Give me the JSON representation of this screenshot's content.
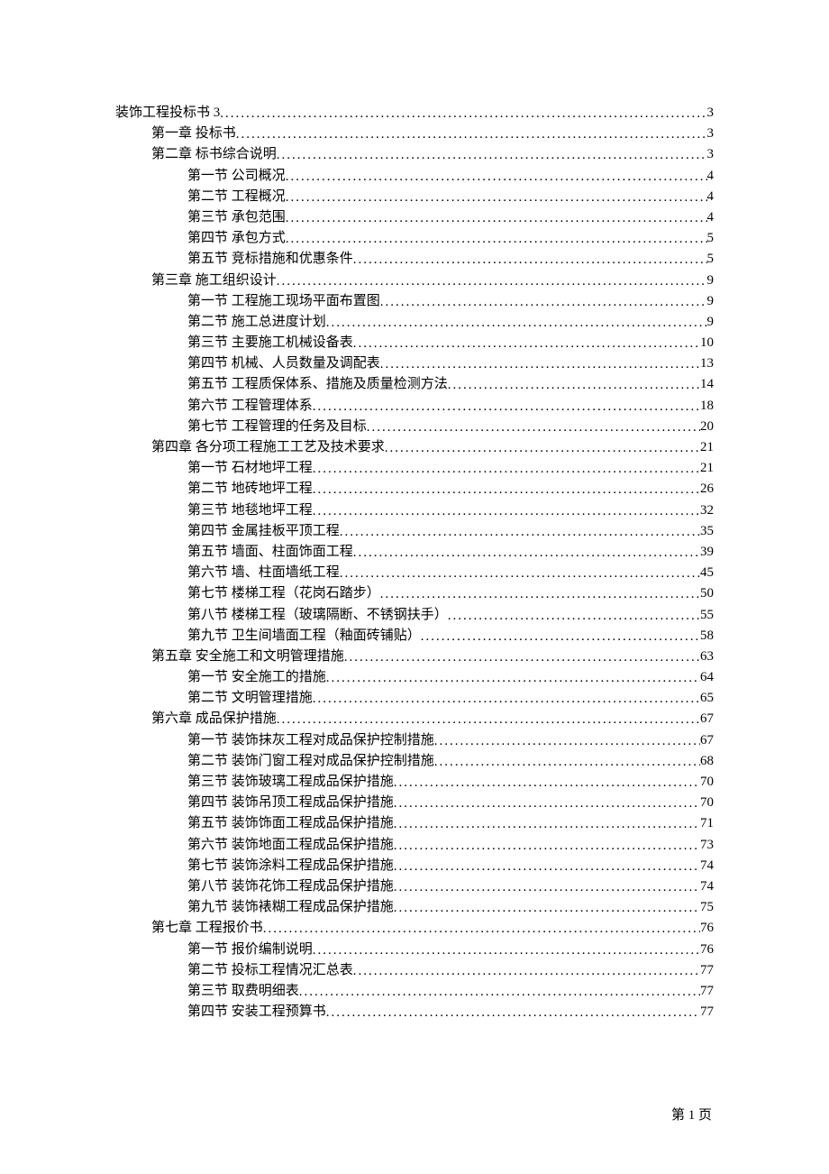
{
  "toc": [
    {
      "level": 0,
      "label": "装饰工程投标书 3",
      "page": "3"
    },
    {
      "level": 1,
      "label": "第一章 投标书",
      "page": "3"
    },
    {
      "level": 1,
      "label": "第二章 标书综合说明",
      "page": "3"
    },
    {
      "level": 2,
      "label": "第一节 公司概况",
      "page": "4"
    },
    {
      "level": 2,
      "label": "第二节 工程概况",
      "page": "4"
    },
    {
      "level": 2,
      "label": "第三节 承包范围",
      "page": "4"
    },
    {
      "level": 2,
      "label": "第四节 承包方式",
      "page": "5"
    },
    {
      "level": 2,
      "label": "第五节 竞标措施和优惠条件",
      "page": "5"
    },
    {
      "level": 1,
      "label": "第三章 施工组织设计",
      "page": "9"
    },
    {
      "level": 2,
      "label": "第一节 工程施工现场平面布置图",
      "page": "9"
    },
    {
      "level": 2,
      "label": "第二节 施工总进度计划",
      "page": "9"
    },
    {
      "level": 2,
      "label": "第三节 主要施工机械设备表",
      "page": "10"
    },
    {
      "level": 2,
      "label": "第四节 机械、人员数量及调配表",
      "page": "13"
    },
    {
      "level": 2,
      "label": "第五节 工程质保体系、措施及质量检测方法",
      "page": "14"
    },
    {
      "level": 2,
      "label": "第六节 工程管理体系",
      "page": "18"
    },
    {
      "level": 2,
      "label": "第七节 工程管理的任务及目标",
      "page": "20"
    },
    {
      "level": 1,
      "label": "第四章 各分项工程施工工艺及技术要求",
      "page": "21"
    },
    {
      "level": 2,
      "label": "第一节 石材地坪工程",
      "page": "21"
    },
    {
      "level": 2,
      "label": "第二节 地砖地坪工程",
      "page": "26"
    },
    {
      "level": 2,
      "label": "第三节 地毯地坪工程",
      "page": "32"
    },
    {
      "level": 2,
      "label": "第四节 金属挂板平顶工程",
      "page": "35"
    },
    {
      "level": 2,
      "label": "第五节 墙面、柱面饰面工程",
      "page": "39"
    },
    {
      "level": 2,
      "label": "第六节 墙、柱面墙纸工程",
      "page": "45"
    },
    {
      "level": 2,
      "label": "第七节 楼梯工程（花岗石踏步）",
      "page": "50"
    },
    {
      "level": 2,
      "label": "第八节 楼梯工程（玻璃隔断、不锈钢扶手）",
      "page": "55"
    },
    {
      "level": 2,
      "label": "第九节 卫生间墙面工程（釉面砖铺贴）",
      "page": "58"
    },
    {
      "level": 1,
      "label": "第五章 安全施工和文明管理措施",
      "page": "63"
    },
    {
      "level": 2,
      "label": "第一节 安全施工的措施",
      "page": "64"
    },
    {
      "level": 2,
      "label": "第二节 文明管理措施",
      "page": "65"
    },
    {
      "level": 1,
      "label": "第六章 成品保护措施",
      "page": "67"
    },
    {
      "level": 2,
      "label": "第一节 装饰抹灰工程对成品保护控制措施",
      "page": "67"
    },
    {
      "level": 2,
      "label": "第二节 装饰门窗工程对成品保护控制措施",
      "page": "68"
    },
    {
      "level": 2,
      "label": "第三节 装饰玻璃工程成品保护措施",
      "page": "70"
    },
    {
      "level": 2,
      "label": "第四节 装饰吊顶工程成品保护措施",
      "page": "70"
    },
    {
      "level": 2,
      "label": "第五节 装饰饰面工程成品保护措施",
      "page": "71"
    },
    {
      "level": 2,
      "label": "第六节 装饰地面工程成品保护措施",
      "page": "73"
    },
    {
      "level": 2,
      "label": "第七节 装饰涂料工程成品保护措施",
      "page": "74"
    },
    {
      "level": 2,
      "label": "第八节 装饰花饰工程成品保护措施",
      "page": "74"
    },
    {
      "level": 2,
      "label": "第九节 装饰裱糊工程成品保护措施",
      "page": "75"
    },
    {
      "level": 1,
      "label": "第七章 工程报价书",
      "page": "76"
    },
    {
      "level": 2,
      "label": "第一节 报价编制说明",
      "page": "76"
    },
    {
      "level": 2,
      "label": "第二节 投标工程情况汇总表",
      "page": "77"
    },
    {
      "level": 2,
      "label": "第三节 取费明细表",
      "page": "77"
    },
    {
      "level": 2,
      "label": "第四节 安装工程预算书",
      "page": "77"
    }
  ],
  "footer": {
    "page_label": "第 1 页"
  }
}
